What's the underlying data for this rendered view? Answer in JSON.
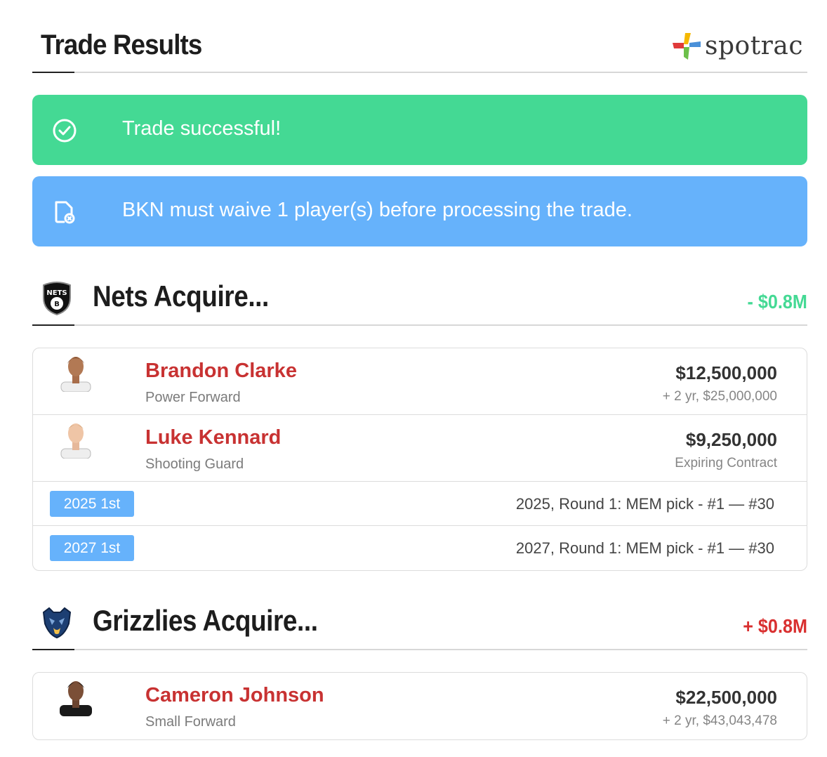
{
  "header": {
    "title": "Trade Results",
    "brand": "spotrac"
  },
  "alerts": {
    "success": {
      "text": "Trade successful!",
      "icon": "check-circle-icon"
    },
    "info": {
      "text": "BKN must waive 1 player(s) before processing the trade.",
      "icon": "document-x-icon"
    }
  },
  "colors": {
    "success": "#44d994",
    "info": "#66b2fb",
    "player_name": "#c83232",
    "positive": "#44d994",
    "negative": "#d93030"
  },
  "nets": {
    "title": "Nets Acquire...",
    "delta": "- $0.8M",
    "players": [
      {
        "name": "Brandon Clarke",
        "position": "Power Forward",
        "salary": "$12,500,000",
        "contract": "+ 2 yr, $25,000,000"
      },
      {
        "name": "Luke Kennard",
        "position": "Shooting Guard",
        "salary": "$9,250,000",
        "contract": "Expiring Contract"
      }
    ],
    "picks": [
      {
        "badge": "2025 1st",
        "desc": "2025, Round 1: MEM pick - #1 — #30"
      },
      {
        "badge": "2027 1st",
        "desc": "2027, Round 1: MEM pick - #1 — #30"
      }
    ]
  },
  "grizzlies": {
    "title": "Grizzlies Acquire...",
    "delta": "+ $0.8M",
    "players": [
      {
        "name": "Cameron Johnson",
        "position": "Small Forward",
        "salary": "$22,500,000",
        "contract": "+ 2 yr, $43,043,478"
      }
    ]
  }
}
